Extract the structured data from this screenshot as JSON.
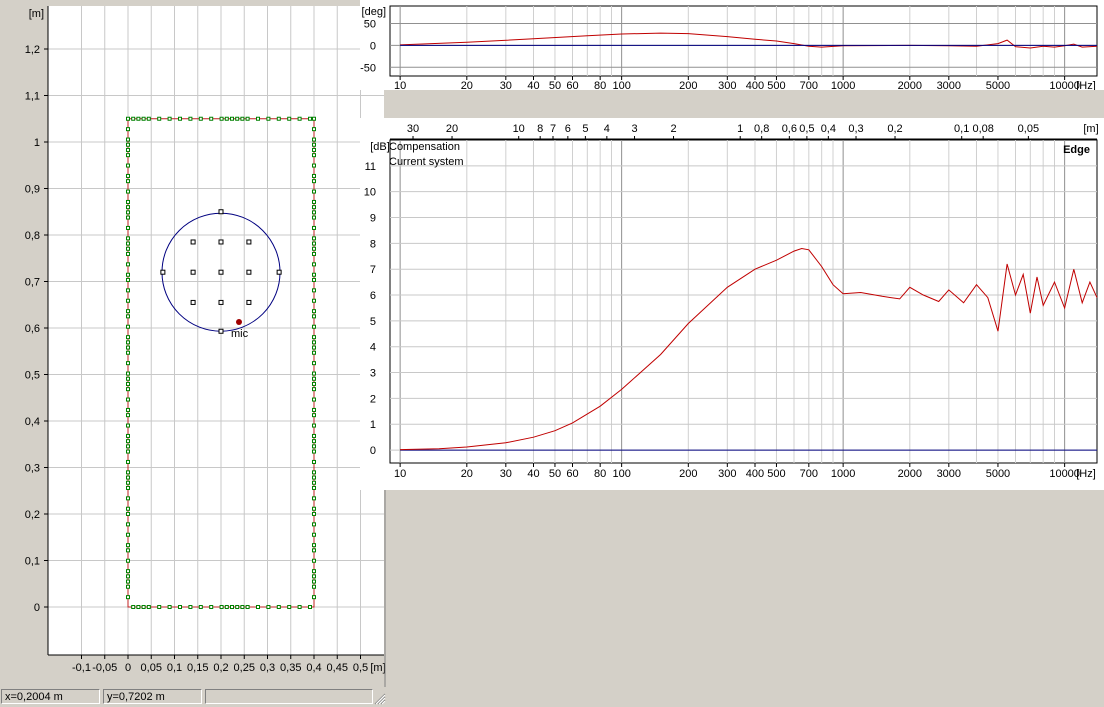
{
  "layout_view": {
    "y_unit_label": "[m]",
    "x_unit_label": "[m]",
    "y_ticks": [
      "1,2",
      "1,1",
      "1",
      "0,9",
      "0,8",
      "0,7",
      "0,6",
      "0,5",
      "0,4",
      "0,3",
      "0,2",
      "0,1",
      "0"
    ],
    "x_ticks": [
      "-0,1",
      "-0,05",
      "0",
      "0,05",
      "0,1",
      "0,15",
      "0,2",
      "0,25",
      "0,3",
      "0,35",
      "0,4",
      "0,45",
      "0,5"
    ],
    "mic_label": "mic",
    "colors": {
      "enclosure": "#c02020",
      "boundary_markers": "#008000",
      "driver_circle": "#000080",
      "mic": "#a00000",
      "grid": "#c8c8c8"
    }
  },
  "phase_chart": {
    "y_unit_label": "[deg]",
    "y_ticks": [
      "50",
      "0",
      "-50"
    ],
    "x_ticks": [
      "10",
      "20",
      "30",
      "40",
      "50",
      "60",
      "80",
      "100",
      "200",
      "300",
      "400",
      "500",
      "700",
      "1000",
      "2000",
      "3000",
      "5000",
      "10000"
    ],
    "x_unit_label": "[Hz]"
  },
  "magnitude_chart": {
    "y_unit_label": "[dB]",
    "top_unit_label": "[m]",
    "top_ticks": [
      "30",
      "20",
      "10",
      "8",
      "7",
      "6",
      "5",
      "4",
      "3",
      "2",
      "1",
      "0,8",
      "0,6",
      "0,5",
      "0,4",
      "0,3",
      "0,2",
      "0,1",
      "0,08",
      "0,05"
    ],
    "y_ticks": [
      "11",
      "10",
      "9",
      "8",
      "7",
      "6",
      "5",
      "4",
      "3",
      "2",
      "1",
      "0"
    ],
    "x_ticks": [
      "10",
      "20",
      "30",
      "40",
      "50",
      "60",
      "80",
      "100",
      "200",
      "300",
      "400",
      "500",
      "700",
      "1000",
      "2000",
      "3000",
      "5000",
      "10000"
    ],
    "x_unit_label": "[Hz]",
    "legend": [
      {
        "label": "Compensation",
        "color": "#000080"
      },
      {
        "label": "Current system",
        "color": "#c00000"
      }
    ],
    "watermark": "Edge"
  },
  "status_bar": {
    "x_readout": "x=0,2004 m",
    "y_readout": "y=0,7202 m"
  },
  "chart_data": [
    {
      "type": "line",
      "title": "",
      "xlabel": "[Hz]",
      "ylabel": "[deg]",
      "xscale": "log",
      "xlim": [
        9,
        14000
      ],
      "ylim": [
        -70,
        90
      ],
      "grid": true,
      "series": [
        {
          "color": "#c00000",
          "points": [
            [
              10,
              1
            ],
            [
              20,
              7
            ],
            [
              40,
              15
            ],
            [
              70,
              22
            ],
            [
              100,
              26
            ],
            [
              150,
              28
            ],
            [
              200,
              27
            ],
            [
              300,
              20
            ],
            [
              400,
              14
            ],
            [
              500,
              10
            ],
            [
              600,
              4
            ],
            [
              700,
              -2
            ],
            [
              800,
              -4
            ],
            [
              1000,
              -1
            ],
            [
              2000,
              0
            ],
            [
              3000,
              -1
            ],
            [
              4000,
              -2
            ],
            [
              5000,
              4
            ],
            [
              5500,
              12
            ],
            [
              6000,
              -3
            ],
            [
              7000,
              -6
            ],
            [
              8000,
              -2
            ],
            [
              9000,
              -4
            ],
            [
              10000,
              -1
            ],
            [
              11000,
              3
            ],
            [
              12000,
              -4
            ],
            [
              14000,
              -2
            ]
          ]
        },
        {
          "color": "#000080",
          "points": [
            [
              10,
              0
            ],
            [
              14000,
              0
            ]
          ]
        }
      ]
    },
    {
      "type": "line",
      "title": "",
      "xlabel": "[Hz]",
      "ylabel": "[dB]",
      "xscale": "log",
      "xlim": [
        9,
        14000
      ],
      "ylim": [
        -0.5,
        12
      ],
      "grid": true,
      "legend_position": "top-left",
      "series": [
        {
          "name": "Compensation",
          "color": "#000080",
          "points": [
            [
              10,
              0
            ],
            [
              14000,
              0
            ]
          ]
        },
        {
          "name": "Current system",
          "color": "#c00000",
          "points": [
            [
              10,
              0.02
            ],
            [
              15,
              0.05
            ],
            [
              20,
              0.12
            ],
            [
              30,
              0.28
            ],
            [
              40,
              0.5
            ],
            [
              50,
              0.75
            ],
            [
              60,
              1.05
            ],
            [
              80,
              1.7
            ],
            [
              100,
              2.35
            ],
            [
              150,
              3.7
            ],
            [
              200,
              4.9
            ],
            [
              300,
              6.3
            ],
            [
              400,
              7.0
            ],
            [
              500,
              7.35
            ],
            [
              600,
              7.7
            ],
            [
              650,
              7.8
            ],
            [
              700,
              7.75
            ],
            [
              800,
              7.1
            ],
            [
              900,
              6.4
            ],
            [
              1000,
              6.05
            ],
            [
              1200,
              6.1
            ],
            [
              1500,
              5.95
            ],
            [
              1800,
              5.85
            ],
            [
              2000,
              6.3
            ],
            [
              2300,
              6.0
            ],
            [
              2700,
              5.75
            ],
            [
              3000,
              6.2
            ],
            [
              3500,
              5.7
            ],
            [
              4000,
              6.4
            ],
            [
              4500,
              5.9
            ],
            [
              5000,
              4.6
            ],
            [
              5500,
              7.2
            ],
            [
              6000,
              6.0
            ],
            [
              6500,
              6.8
            ],
            [
              7000,
              5.3
            ],
            [
              7500,
              6.7
            ],
            [
              8000,
              5.6
            ],
            [
              9000,
              6.5
            ],
            [
              10000,
              5.5
            ],
            [
              11000,
              7.0
            ],
            [
              12000,
              5.7
            ],
            [
              13000,
              6.5
            ],
            [
              14000,
              5.9
            ]
          ]
        }
      ]
    }
  ]
}
